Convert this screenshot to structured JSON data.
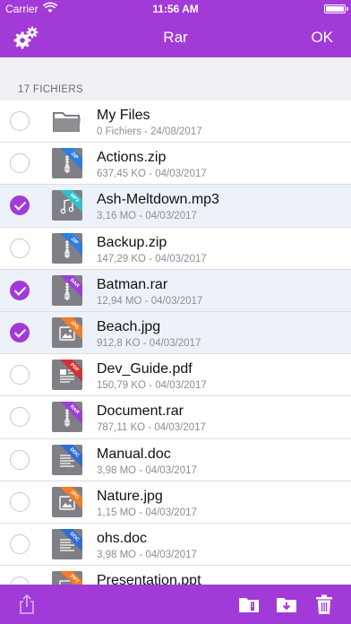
{
  "status_bar": {
    "carrier": "Carrier",
    "time": "11:56 AM",
    "battery_level": 1.0
  },
  "nav": {
    "title": "Rar",
    "ok_label": "OK"
  },
  "section": {
    "header": "17 FICHIERS"
  },
  "colors": {
    "accent": "#a23ad8",
    "selected_row": "#edf2fa"
  },
  "files": [
    {
      "name": "My Files",
      "meta": "0 Fichiers - 24/08/2017",
      "icon": "folder-icon",
      "selected": false
    },
    {
      "name": "Actions.zip",
      "meta": "637,45 KO - 04/03/2017",
      "icon": "zip-icon",
      "tag": "ZIP",
      "tag_color": "#2f7de1",
      "selected": false
    },
    {
      "name": "Ash-Meltdown.mp3",
      "meta": "3,16 MO - 04/03/2017",
      "icon": "music-icon",
      "tag": "MP3",
      "tag_color": "#2fbfd0",
      "selected": true
    },
    {
      "name": "Backup.zip",
      "meta": "147,29 KO - 04/03/2017",
      "icon": "zip-icon",
      "tag": "ZIP",
      "tag_color": "#2f7de1",
      "selected": false
    },
    {
      "name": "Batman.rar",
      "meta": "12,94 MO - 04/03/2017",
      "icon": "zip-icon",
      "tag": "RAR",
      "tag_color": "#9b3fd6",
      "selected": true
    },
    {
      "name": "Beach.jpg",
      "meta": "912,8 KO - 04/03/2017",
      "icon": "image-icon",
      "tag": "JPG",
      "tag_color": "#f07d2a",
      "selected": true
    },
    {
      "name": "Dev_Guide.pdf",
      "meta": "150,79 KO - 04/03/2017",
      "icon": "pdf-icon",
      "tag": "PDF",
      "tag_color": "#d62f2f",
      "selected": false
    },
    {
      "name": "Document.rar",
      "meta": "787,11 KO - 04/03/2017",
      "icon": "zip-icon",
      "tag": "RAR",
      "tag_color": "#9b3fd6",
      "selected": false
    },
    {
      "name": "Manual.doc",
      "meta": "3,98 MO - 04/03/2017",
      "icon": "text-icon",
      "tag": "DOC",
      "tag_color": "#2f6dd6",
      "selected": false
    },
    {
      "name": "Nature.jpg",
      "meta": "1,15 MO - 04/03/2017",
      "icon": "image-icon",
      "tag": "JPG",
      "tag_color": "#f07d2a",
      "selected": false
    },
    {
      "name": "ohs.doc",
      "meta": "3,98 MO - 04/03/2017",
      "icon": "text-icon",
      "tag": "DOC",
      "tag_color": "#2f6dd6",
      "selected": false
    },
    {
      "name": "Presentation.ppt",
      "meta": "",
      "icon": "slides-icon",
      "tag": "PPT",
      "tag_color": "#f07d2a",
      "selected": false
    }
  ]
}
